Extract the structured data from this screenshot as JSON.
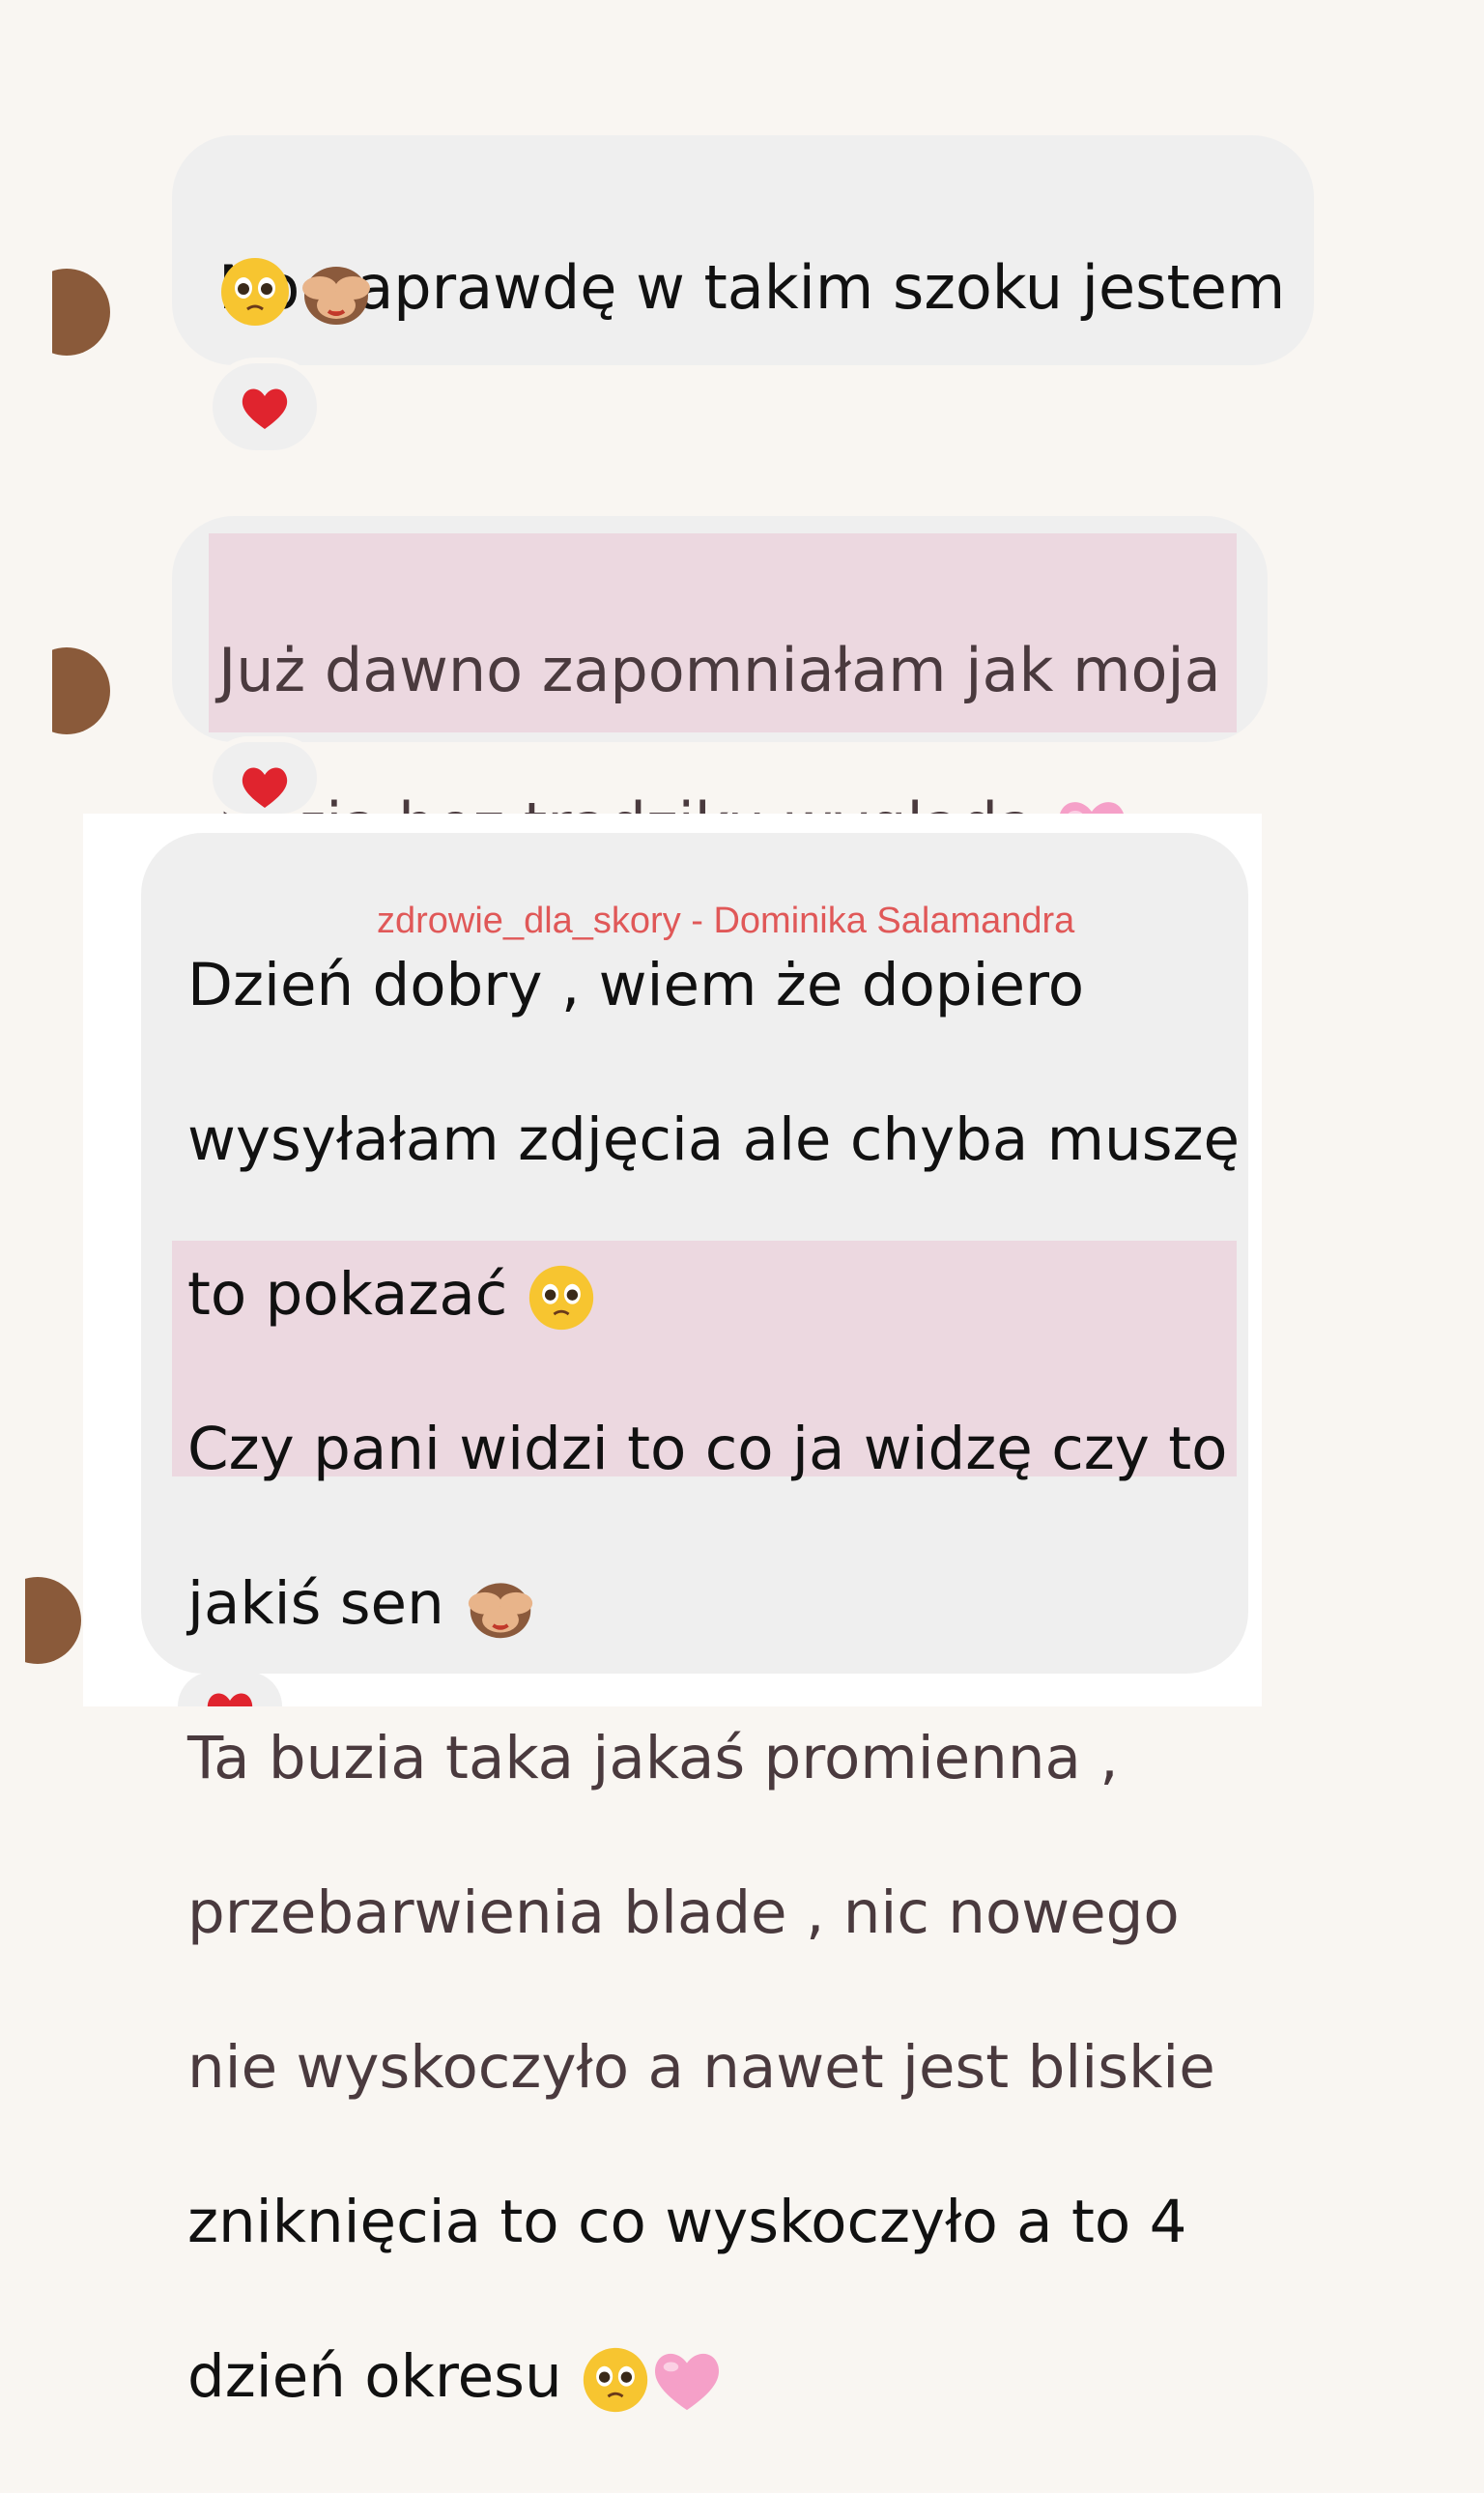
{
  "messages": [
    {
      "lines": [
        "No naprawdę w takim szoku jestem"
      ],
      "emojis": [
        "pleading-face-icon",
        "see-no-evil-monkey-icon"
      ],
      "reaction": "red-heart-icon"
    },
    {
      "lines": [
        "Już dawno zapomniałam jak moja",
        "buzia bez trądziku wygląda"
      ],
      "emojis": [
        "pink-heart-icon"
      ],
      "reaction": "red-heart-icon"
    },
    {
      "lines": [
        "Dzień dobry , wiem że dopiero",
        "wysyłałam zdjęcia ale chyba muszę",
        "to pokazać",
        "Czy pani widzi to co ja widzę czy to",
        "jakiś sen",
        "Ta buzia taka jakaś promienna ,",
        "przebarwienia blade , nic nowego",
        "nie wyskoczyło a nawet jest bliskie",
        "zniknięcia to co wyskoczyło a to 4",
        "dzień okresu"
      ],
      "emojis": [
        "pleading-face-icon",
        "see-no-evil-monkey-icon",
        "pleading-face-icon",
        "pink-heart-icon"
      ],
      "reaction": "red-heart-icon"
    }
  ],
  "watermark": "zdrowie_dla_skory - Dominika Salamandra",
  "colors": {
    "background": "#f9f6f2",
    "bubble": "#efefef",
    "highlight": "#ecd8e0",
    "watermark": "#e05858",
    "heart_red": "#e0242e",
    "heart_pink": "#f5a0c8"
  }
}
